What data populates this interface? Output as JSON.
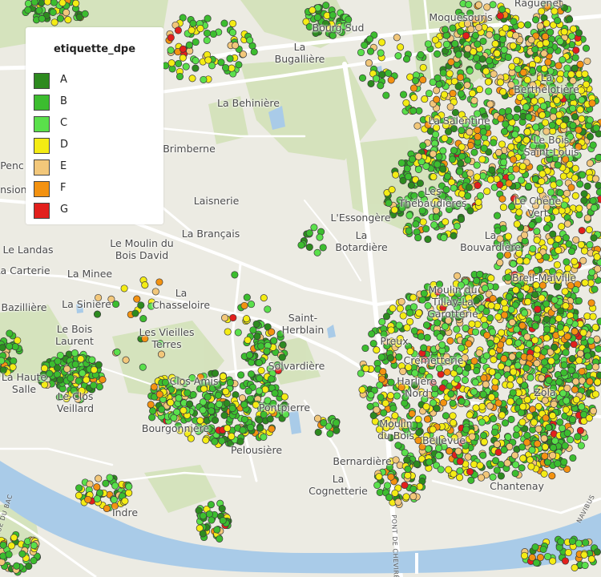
{
  "legend": {
    "title": "etiquette_dpe",
    "items": [
      {
        "label": "A",
        "color": "#2d8a1f"
      },
      {
        "label": "B",
        "color": "#3cbd2f"
      },
      {
        "label": "C",
        "color": "#5ae04b"
      },
      {
        "label": "D",
        "color": "#f4ec14"
      },
      {
        "label": "E",
        "color": "#f2c77a"
      },
      {
        "label": "F",
        "color": "#f39211"
      },
      {
        "label": "G",
        "color": "#e2201d"
      }
    ]
  },
  "places": [
    "Raguenet",
    "Moquesouris",
    "Bourg Sud",
    "La\nBugallière",
    "La\nBerthelotière",
    "La Behinière",
    "La Salentine",
    "Le Bois\nSaint-Louis",
    "Brimberne",
    "Le Chêne\nVert",
    "Les\nThébaudières",
    "Laisnerie",
    "L'Essongère",
    "La\nBotardière",
    "La Brançais",
    "Le Moulin du\nBois David",
    "Le Landas",
    "La Carterie",
    "La Minee",
    "La\nBouvardière",
    "Breil-Malville",
    "Moulin du\nTillay-La\nGarotterie",
    "La\nChasseloire",
    "La Siniere",
    "Bazillière",
    "Saint-\nHerblain",
    "Les Vieilles\nTerres",
    "Le Bois\nLaurent",
    "Preux",
    "Crémetterie",
    "Solvardière",
    "Harlière\nNord",
    "Zola",
    "La Haute\nSalle",
    "Clos Amis",
    "Le Clos\nVeillard",
    "Pontpierre",
    "Bourgonnière",
    "Moulin\ndu Bois",
    "Bellevue",
    "Pelousière",
    "Bernardière",
    "Chantenay",
    "La\nCognetterie",
    "Indre",
    "Penc",
    "ension"
  ],
  "road_labels": [
    "RUE DU BAC",
    "PONT DE CHEVIRÉ",
    "NAVIBUS"
  ],
  "colors": {
    "land": "#ecebe3",
    "green_area": "#d3e2b8",
    "water": "#a9cbe8",
    "road": "#ffffff"
  }
}
